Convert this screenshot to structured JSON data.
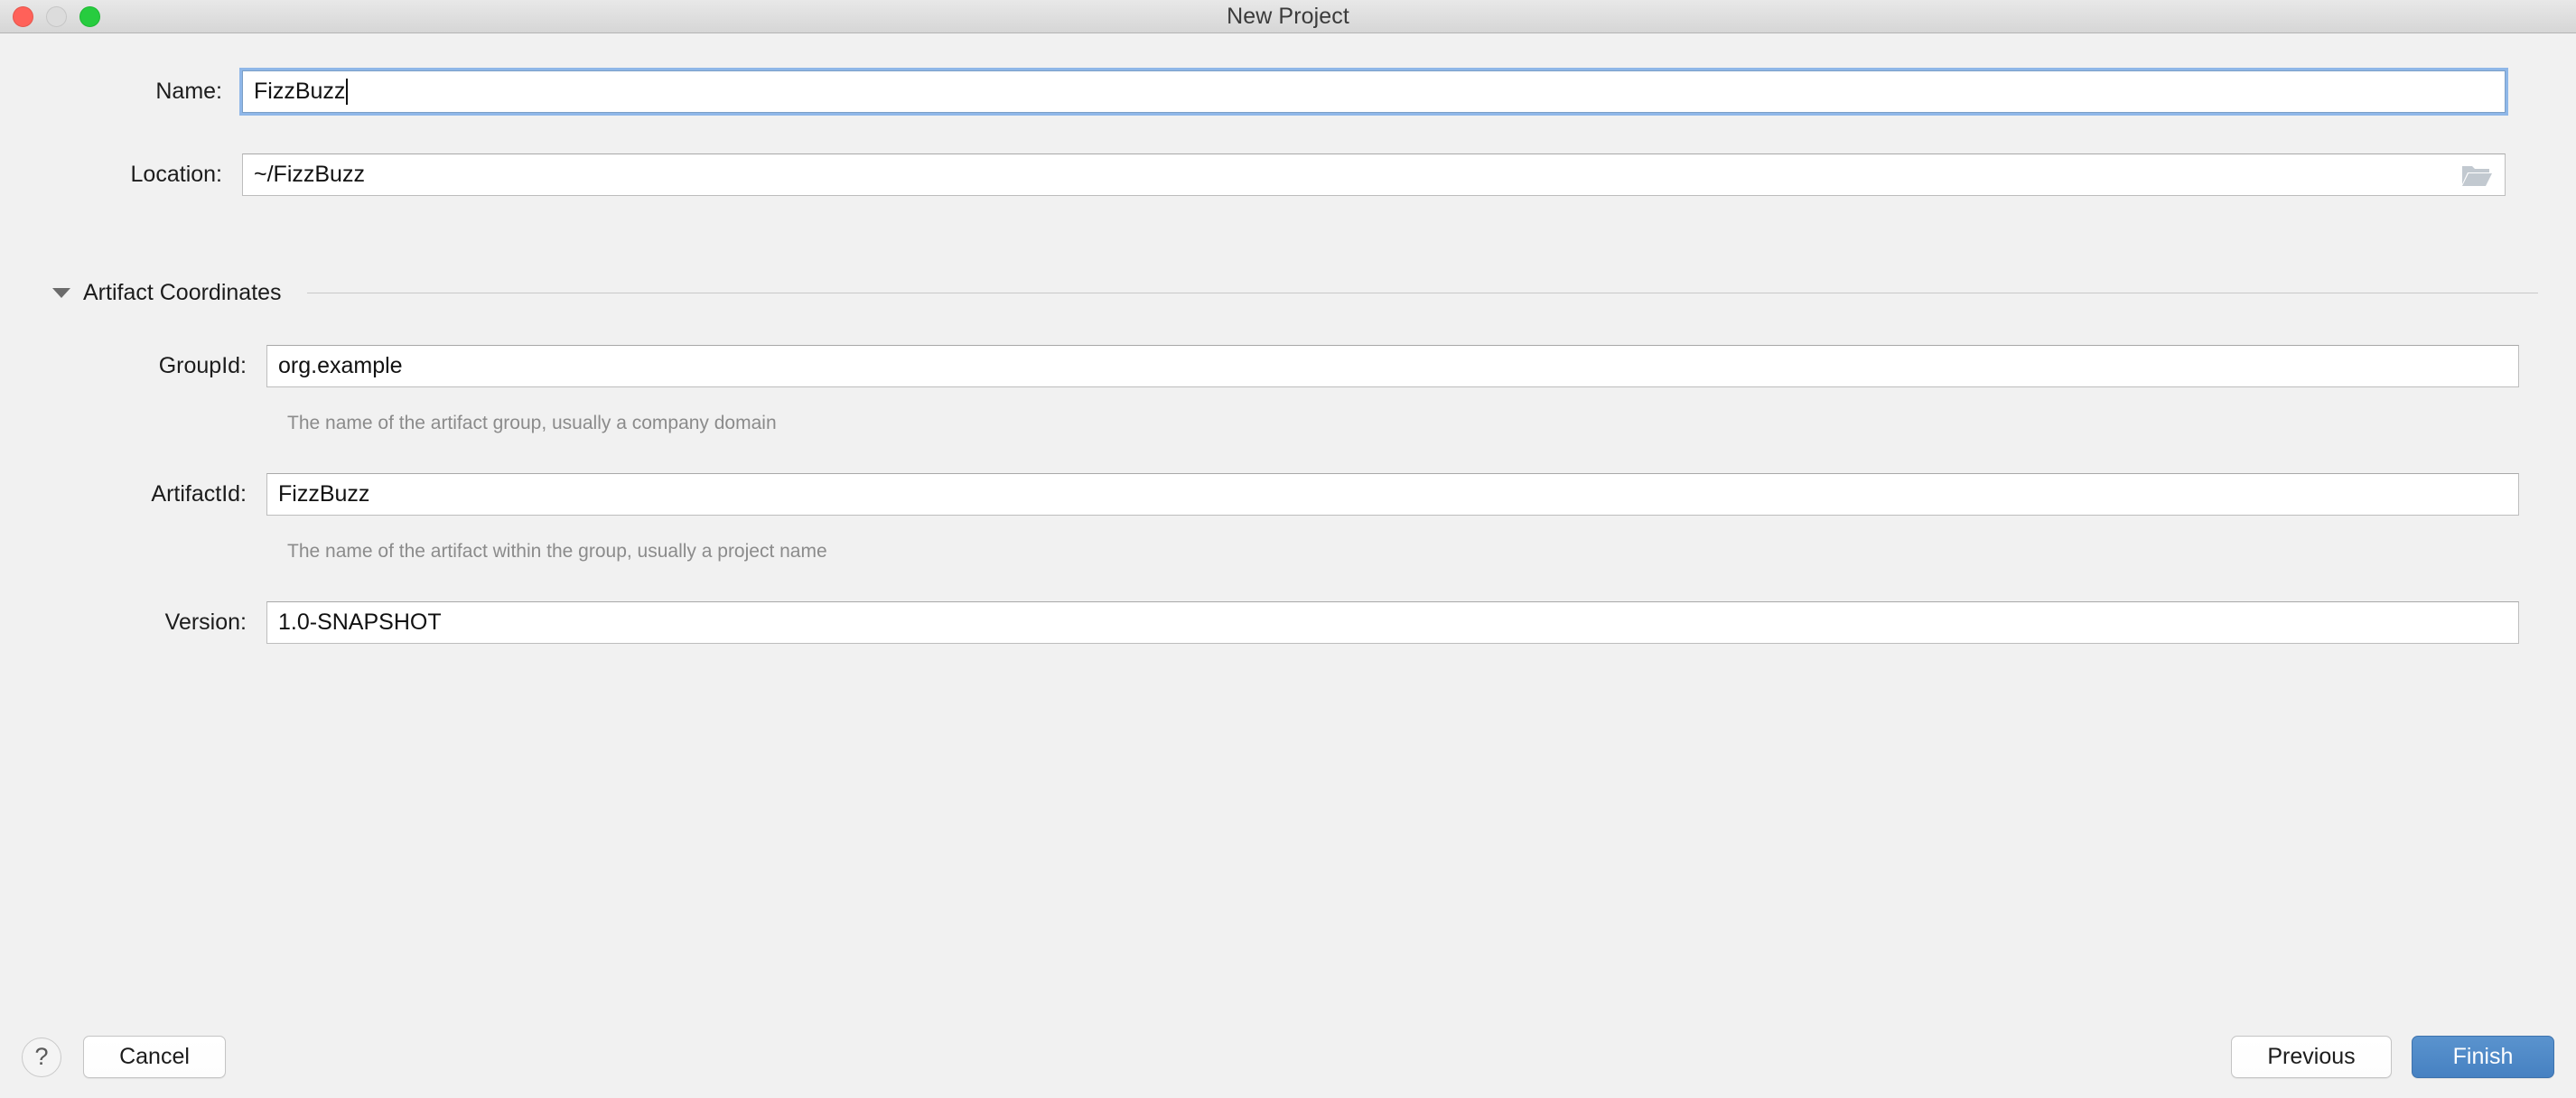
{
  "window": {
    "title": "New Project",
    "traffic_lights": [
      {
        "name": "close",
        "color": "#ff6159",
        "enabled": true
      },
      {
        "name": "minimize",
        "color": "#dcdcdc",
        "enabled": false
      },
      {
        "name": "zoom",
        "color": "#27cc3f",
        "enabled": true
      }
    ]
  },
  "form": {
    "name": {
      "label": "Name:",
      "value": "FizzBuzz",
      "focused": true
    },
    "location": {
      "label": "Location:",
      "value": "~/FizzBuzz",
      "browse_icon": "folder-icon"
    }
  },
  "artifact_section": {
    "title": "Artifact Coordinates",
    "expanded": true,
    "disclosure_icon": "triangle-down-icon",
    "fields": {
      "group_id": {
        "label": "GroupId:",
        "value": "org.example",
        "hint": "The name of the artifact group, usually a company domain"
      },
      "artifact_id": {
        "label": "ArtifactId:",
        "value": "FizzBuzz",
        "hint": "The name of the artifact within the group, usually a project name"
      },
      "version": {
        "label": "Version:",
        "value": "1.0-SNAPSHOT",
        "hint": ""
      }
    }
  },
  "footer": {
    "help_label": "?",
    "cancel_label": "Cancel",
    "previous_label": "Previous",
    "finish_label": "Finish"
  },
  "colors": {
    "window_background": "#f1f1f1",
    "titlebar_top": "#e8e8e8",
    "titlebar_bottom": "#d6d6d6",
    "primary_button": "#4681c2",
    "focus_ring": "#8fb7e8",
    "hint_text": "#8b8b8b",
    "field_border": "#bdbdbd"
  }
}
